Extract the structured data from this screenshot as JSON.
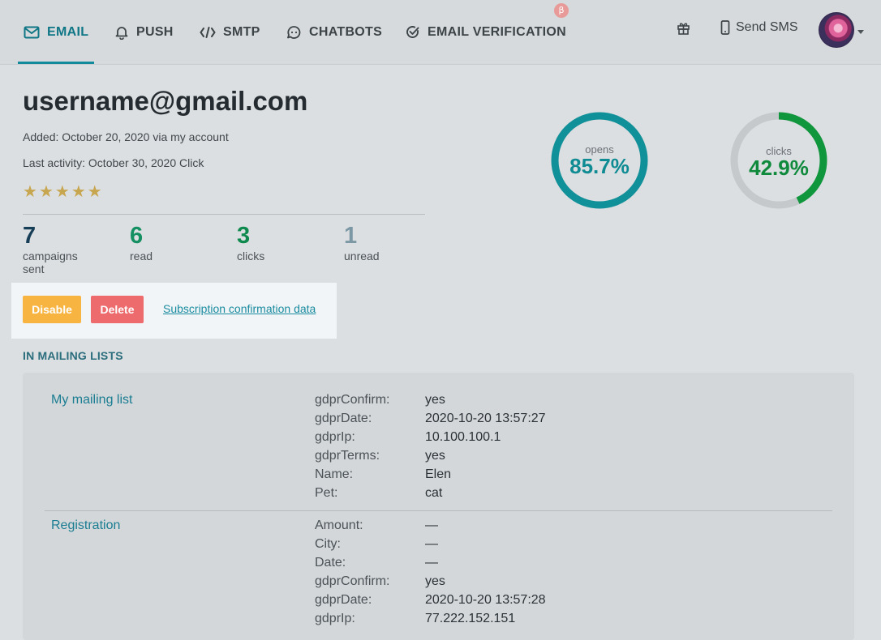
{
  "nav": {
    "items": [
      {
        "label": "EMAIL",
        "icon": "envelope-icon",
        "active": true
      },
      {
        "label": "PUSH",
        "icon": "bell-icon"
      },
      {
        "label": "SMTP",
        "icon": "code-icon"
      },
      {
        "label": "CHATBOTS",
        "icon": "chat-bubble-icon"
      },
      {
        "label": "EMAIL VERIFICATION",
        "icon": "check-circle-icon"
      }
    ],
    "beta_badge": "β",
    "send_sms_label": "Send SMS"
  },
  "profile": {
    "email": "username@gmail.com",
    "added": "Added: October 20, 2020 via my account",
    "last_activity": "Last activity: October 30, 2020 Click",
    "stars": 5,
    "stats": [
      {
        "value": "7",
        "label": "campaigns sent",
        "color": "#173e57"
      },
      {
        "value": "6",
        "label": "read",
        "color": "#149063"
      },
      {
        "value": "3",
        "label": "clicks",
        "color": "#0e8a4f"
      },
      {
        "value": "1",
        "label": "unread",
        "color": "#7c98a5"
      }
    ]
  },
  "actions": {
    "disable_label": "Disable",
    "delete_label": "Delete",
    "subscription_link": "Subscription confirmation data"
  },
  "gauges": [
    {
      "label": "opens",
      "value": "85.7%",
      "fraction": 1.0,
      "color": "#109099"
    },
    {
      "label": "clicks",
      "value": "42.9%",
      "fraction": 0.429,
      "color": "#10963d"
    }
  ],
  "mailing": {
    "section_title": "IN MAILING LISTS",
    "lists": [
      {
        "name": "My mailing list",
        "fields": [
          {
            "key": "gdprConfirm:",
            "value": "yes"
          },
          {
            "key": "gdprDate:",
            "value": "2020-10-20 13:57:27"
          },
          {
            "key": "gdprIp:",
            "value": "10.100.100.1"
          },
          {
            "key": "gdprTerms:",
            "value": "yes"
          },
          {
            "key": "Name:",
            "value": "Elen"
          },
          {
            "key": "Pet:",
            "value": "cat"
          }
        ]
      },
      {
        "name": "Registration",
        "fields": [
          {
            "key": "Amount:",
            "value": "—"
          },
          {
            "key": "City:",
            "value": "—"
          },
          {
            "key": "Date:",
            "value": "—"
          },
          {
            "key": "gdprConfirm:",
            "value": "yes"
          },
          {
            "key": "gdprDate:",
            "value": "2020-10-20 13:57:28"
          },
          {
            "key": "gdprIp:",
            "value": "77.222.152.151"
          }
        ]
      }
    ]
  }
}
